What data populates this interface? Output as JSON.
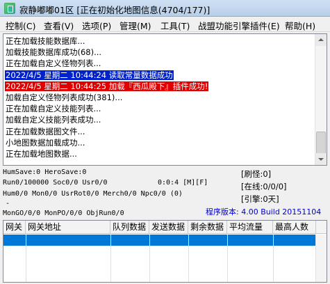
{
  "window": {
    "title": "寂静嘟嘟01区 [正在初始化地图信息(4704/177)]"
  },
  "menu": [
    {
      "label": "控制(C)"
    },
    {
      "label": "查看(V)"
    },
    {
      "label": "选项(P)"
    },
    {
      "label": "管理(M)"
    },
    {
      "label": "工具(T)"
    },
    {
      "label": "战盟功能引擎插件(E)"
    },
    {
      "label": "帮助(H)"
    }
  ],
  "log": [
    {
      "text": "正在加载技能数据库..."
    },
    {
      "text": "加载技能数据库成功(68)..."
    },
    {
      "text": "正在加载自定义怪物列表..."
    },
    {
      "text": "2022/4/5 星期二 10:44:24 读取常量数据成功",
      "highlight": "#0022cc"
    },
    {
      "text": "2022/4/5 星期二 10:44:25 加载『西瓜殿下』插件成功!",
      "highlight": "#e00000"
    },
    {
      "text": "加载自定义怪物列表成功(381)..."
    },
    {
      "text": "正在加载自定义技能列表..."
    },
    {
      "text": "加载自定义技能列表成功..."
    },
    {
      "text": "正在加载数据图文件..."
    },
    {
      "text": "小地图数据加载成功..."
    },
    {
      "text": "正在加载地图数据..."
    }
  ],
  "status": {
    "humsave": "HumSave:0 HeroSave:0",
    "run": "Run0/100000 Soc0/0 Usr0/0",
    "timer": "0:0:4 [M][F]",
    "hum": "Hum0/0 Mon0/0 UsrRot0/0 Merch0/0 Npc0/0 (0)",
    "dash": "-",
    "mon": "MonGO/0/0 MonPO/0/0 ObjRun0/0",
    "refresh": "[刷怪:0]",
    "online": "[在线:0/0/0]",
    "engine": "[引擎:0天]",
    "version": "程序版本: 4.00 Build 20151104"
  },
  "gateway_table": {
    "columns": [
      "网关",
      "网关地址",
      "队列数据",
      "发送数据",
      "剩余数据",
      "平均流量",
      "最高人数"
    ]
  }
}
